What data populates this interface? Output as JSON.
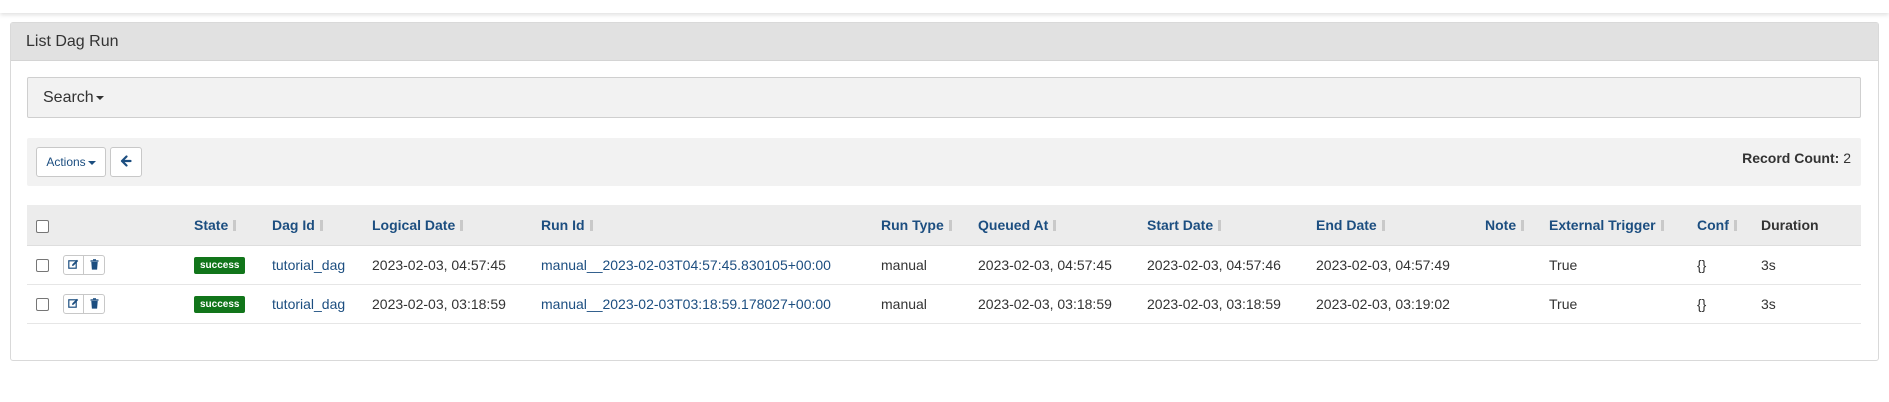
{
  "panel": {
    "title": "List Dag Run"
  },
  "search": {
    "label": "Search"
  },
  "toolbar": {
    "actions_label": "Actions",
    "record_count_label": "Record Count:",
    "record_count": "2"
  },
  "table": {
    "columns": [
      "State",
      "Dag Id",
      "Logical Date",
      "Run Id",
      "Run Type",
      "Queued At",
      "Start Date",
      "End Date",
      "Note",
      "External Trigger",
      "Conf",
      "Duration"
    ],
    "rows": [
      {
        "state": "success",
        "dag_id": "tutorial_dag",
        "logical_date": "2023-02-03, 04:57:45",
        "run_id": "manual__2023-02-03T04:57:45.830105+00:00",
        "run_type": "manual",
        "queued_at": "2023-02-03, 04:57:45",
        "start_date": "2023-02-03, 04:57:46",
        "end_date": "2023-02-03, 04:57:49",
        "note": "",
        "external_trigger": "True",
        "conf": "{}",
        "duration": "3s"
      },
      {
        "state": "success",
        "dag_id": "tutorial_dag",
        "logical_date": "2023-02-03, 03:18:59",
        "run_id": "manual__2023-02-03T03:18:59.178027+00:00",
        "run_type": "manual",
        "queued_at": "2023-02-03, 03:18:59",
        "start_date": "2023-02-03, 03:18:59",
        "end_date": "2023-02-03, 03:19:02",
        "note": "",
        "external_trigger": "True",
        "conf": "{}",
        "duration": "3s"
      }
    ]
  },
  "colors": {
    "link": "#1c4e80",
    "success": "#11751a",
    "header_bg": "#e1e1e1"
  }
}
